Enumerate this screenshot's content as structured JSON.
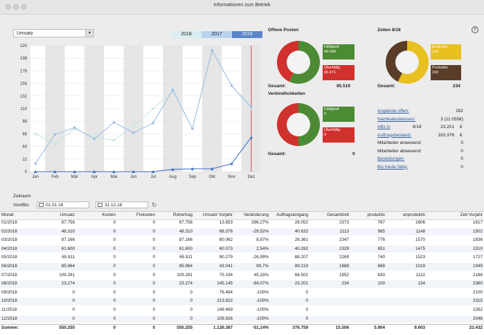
{
  "window": {
    "title": "Informationen zum Betrieb"
  },
  "chart_panel": {
    "metric_select": "Umsatz",
    "years": [
      {
        "label": "2018",
        "color": "#d9eef0"
      },
      {
        "label": "2017",
        "color": "#b9d3ef"
      },
      {
        "label": "2016",
        "color": "#5b86c8"
      }
    ],
    "zeitraum_label": "Zeitraum",
    "from_label": "Von/Bis:",
    "from_date": "01.01.18",
    "to_date": "31.12.18"
  },
  "chart_data": {
    "type": "line",
    "categories": [
      "Jan",
      "Feb",
      "Mär",
      "Apr",
      "Mai",
      "Jun",
      "Jul",
      "Aug",
      "Sep",
      "Okt",
      "Nov",
      "Dez"
    ],
    "yticks": [
      0,
      22,
      44,
      66,
      88,
      110,
      132,
      154,
      176,
      198,
      220
    ],
    "ylim": [
      0,
      220
    ],
    "series": [
      {
        "name": "2018",
        "color": "#c9e6e3",
        "values": [
          66,
          48,
          75,
          60,
          55,
          80,
          110,
          140,
          75,
          210,
          150,
          110
        ]
      },
      {
        "name": "2017",
        "color": "#9fbde6",
        "values": [
          14,
          65,
          77,
          57,
          86,
          68,
          85,
          143,
          75,
          212,
          150,
          113
        ]
      },
      {
        "name": "2016",
        "color": "#3d6fc4",
        "values": [
          0,
          0,
          0,
          0,
          0,
          0,
          0,
          4,
          5,
          5,
          14,
          60
        ]
      }
    ],
    "marker_month": "Dez",
    "marker_color": "#e04040"
  },
  "offene_posten": {
    "title": "Offene Posten",
    "segments": [
      {
        "label": "Fälligkeit",
        "value": "49.048",
        "color": "#4d8a34",
        "share": 0.57
      },
      {
        "label": "Überfällig",
        "value": "36.471",
        "color": "#d0312d",
        "share": 0.43
      }
    ],
    "total_label": "Gesamt:",
    "total_value": "85.519"
  },
  "verbindlichkeiten": {
    "title": "Verbindlichkeiten",
    "segments": [
      {
        "label": "Fälligkeit",
        "value": "0",
        "color": "#4d8a34",
        "share": 0.5
      },
      {
        "label": "Überfällig",
        "value": "0",
        "color": "#d0312d",
        "share": 0.5
      }
    ],
    "total_label": "Gesamt:",
    "total_value": "0"
  },
  "zeiten": {
    "title": "Zeiten 8/18",
    "segments": [
      {
        "label": "produktiv",
        "value": "134",
        "color": "#e8c020",
        "share": 0.57
      },
      {
        "label": "Produktiv",
        "value": "100",
        "color": "#5a3d28",
        "share": 0.43
      }
    ],
    "total_label": "Gesamt:",
    "total_value": "234"
  },
  "kennzahlen": [
    {
      "label": "Angebote offen:",
      "value": "282",
      "extra": "",
      "link": true
    },
    {
      "label": "Nachkalkulationen:",
      "value": "3 (11.055€)",
      "extra": "",
      "link": true
    },
    {
      "label": "ABs in",
      "value": "23.201",
      "extra": "8/18",
      "unit": "€",
      "link": true
    },
    {
      "label": "Auftragsbestand:",
      "value": "163.376",
      "extra": "",
      "unit": "€",
      "link": true
    },
    {
      "label": "Mitarbeiter anwesend:",
      "value": "0",
      "extra": "",
      "link": false
    },
    {
      "label": "Mitarbeiter abwesend:",
      "value": "0",
      "extra": "",
      "link": false
    },
    {
      "label": "Bestellungen:",
      "value": "0",
      "extra": "",
      "link": true
    },
    {
      "label": "Bis heute fällig:",
      "value": "0",
      "extra": "",
      "link": true
    }
  ],
  "table": {
    "headers": [
      "Monat",
      "Umsatz",
      "Kosten",
      "Fixkosten",
      "Rohertrag",
      "Umsatz Vorjahr",
      "Veränderung",
      "Auftragseingang",
      "Gesamtzeit",
      "produktiv",
      "unproduktiv",
      "Zeit Vorjahr"
    ],
    "rows": [
      [
        "01/2018",
        "67.756",
        "0",
        "0",
        "67.756",
        "13.653",
        "396,27%",
        "28.052",
        "2373",
        "767",
        "1606",
        "1617"
      ],
      [
        "02/2018",
        "48.310",
        "0",
        "0",
        "48.310",
        "68.376",
        "-29,52%",
        "40.632",
        "2113",
        "965",
        "1148",
        "1502"
      ],
      [
        "03/2018",
        "87.166",
        "0",
        "0",
        "87.166",
        "80.062",
        "8,87%",
        "26.361",
        "2347",
        "776",
        "1570",
        "1836"
      ],
      [
        "04/2018",
        "61.600",
        "0",
        "0",
        "61.600",
        "60.073",
        "2,54%",
        "40.282",
        "2329",
        "851",
        "1475",
        "1510"
      ],
      [
        "05/2018",
        "65.911",
        "0",
        "0",
        "65.911",
        "90.279",
        "-26,99%",
        "88.207",
        "2269",
        "740",
        "1523",
        "1727"
      ],
      [
        "06/2018",
        "85.964",
        "0",
        "0",
        "85.964",
        "43.041",
        "99,7%",
        "89.219",
        "1888",
        "868",
        "1019",
        "1949"
      ],
      [
        "07/2018",
        "109.281",
        "0",
        "0",
        "109.281",
        "75.194",
        "45,33%",
        "66.502",
        "1952",
        "830",
        "1122",
        "2186"
      ],
      [
        "08/2018",
        "23.274",
        "0",
        "0",
        "23.274",
        "145.145",
        "-84,07%",
        "23.201",
        "234",
        "100",
        "134",
        "2360"
      ],
      [
        "09/2018",
        "0",
        "0",
        "0",
        "0",
        "76.484",
        "-100%",
        "0",
        "",
        "",
        "",
        "2100"
      ],
      [
        "10/2018",
        "0",
        "0",
        "0",
        "0",
        "213.922",
        "-100%",
        "0",
        "",
        "",
        "",
        "2315"
      ],
      [
        "11/2018",
        "0",
        "0",
        "0",
        "0",
        "149.469",
        "-100%",
        "0",
        "",
        "",
        "",
        "2262"
      ],
      [
        "12/2018",
        "0",
        "0",
        "0",
        "0",
        "109.926",
        "-100%",
        "0",
        "",
        "",
        "",
        "2046"
      ]
    ],
    "sum": [
      "Summe:",
      "550.255",
      "0",
      "0",
      "550.255",
      "1.126.387",
      "-51,14%",
      "376.759",
      "15.506",
      "5.904",
      "9.603",
      "23.432"
    ]
  }
}
